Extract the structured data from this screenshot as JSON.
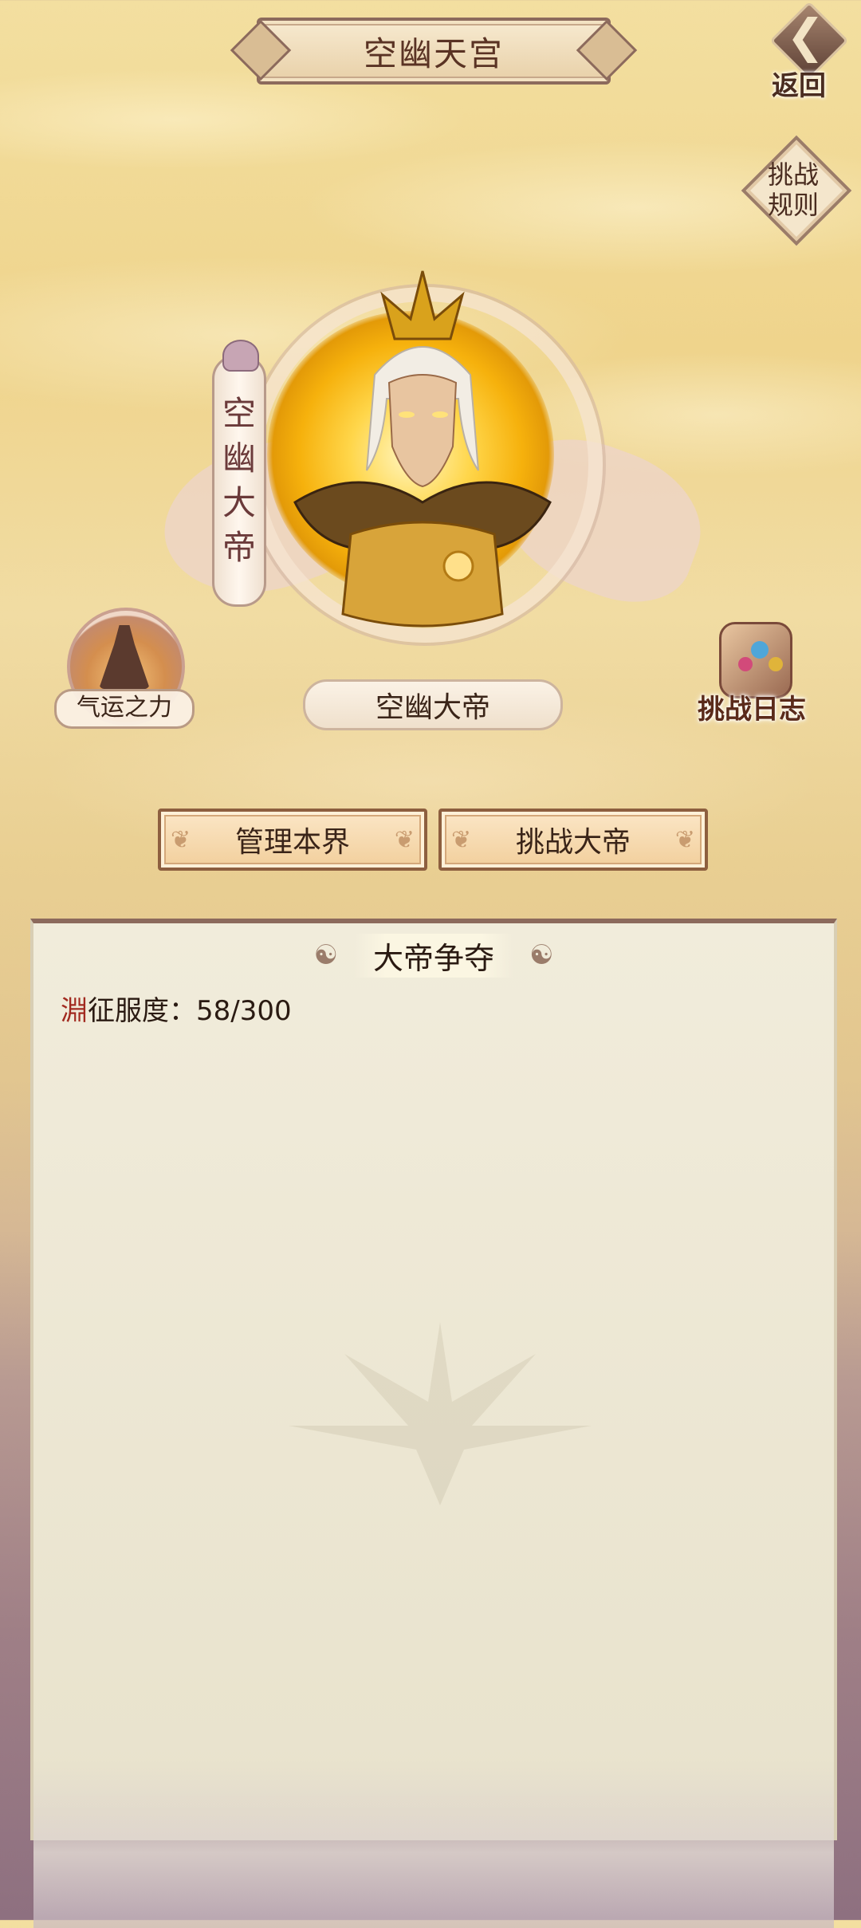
{
  "header": {
    "title": "空幽天宫",
    "back_label": "返回",
    "back_arrow": "❮"
  },
  "rules_button": {
    "label": "挑战规则"
  },
  "emperor": {
    "banner_title": "空幽大帝",
    "name": "空幽大帝"
  },
  "fortune_button": {
    "label": "气运之力"
  },
  "log_button": {
    "label": "挑战日志"
  },
  "actions": {
    "manage_label": "管理本界",
    "challenge_label": "挑战大帝"
  },
  "panel": {
    "title": "大帝争夺",
    "progress_mark": "淵",
    "progress_label": "征服度：58/300",
    "progress_current": 58,
    "progress_max": 300
  },
  "colors": {
    "accent": "#8d5f3f",
    "title_text": "#5a3324",
    "mark": "#a22a20"
  }
}
